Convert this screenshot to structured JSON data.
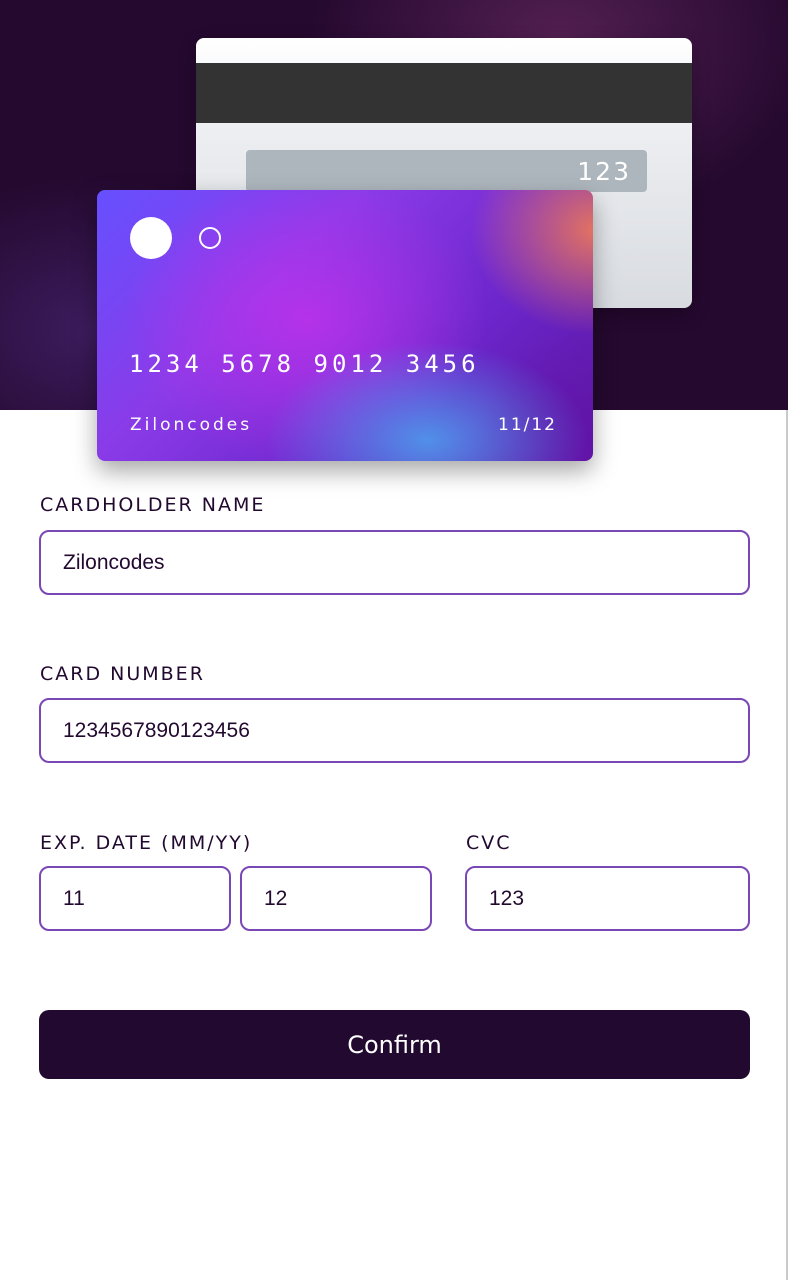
{
  "card_back": {
    "cvc": "123"
  },
  "card_front": {
    "number": "1234  5678  9012  3456",
    "holder": "Ziloncodes",
    "expiry": "11/12"
  },
  "form": {
    "cardholder_label": "CARDHOLDER NAME",
    "cardholder_value": "Ziloncodes",
    "number_label": "CARD NUMBER",
    "number_value": "1234567890123456",
    "exp_label": "EXP. DATE (MM/YY)",
    "exp_month_value": "11",
    "exp_year_value": "12",
    "cvc_label": "CVC",
    "cvc_value": "123",
    "confirm_label": "Confirm"
  },
  "colors": {
    "hero_background": "#25092f",
    "input_border": "#7a47b6",
    "button_background": "#21092f",
    "text_dark": "#21092f"
  }
}
